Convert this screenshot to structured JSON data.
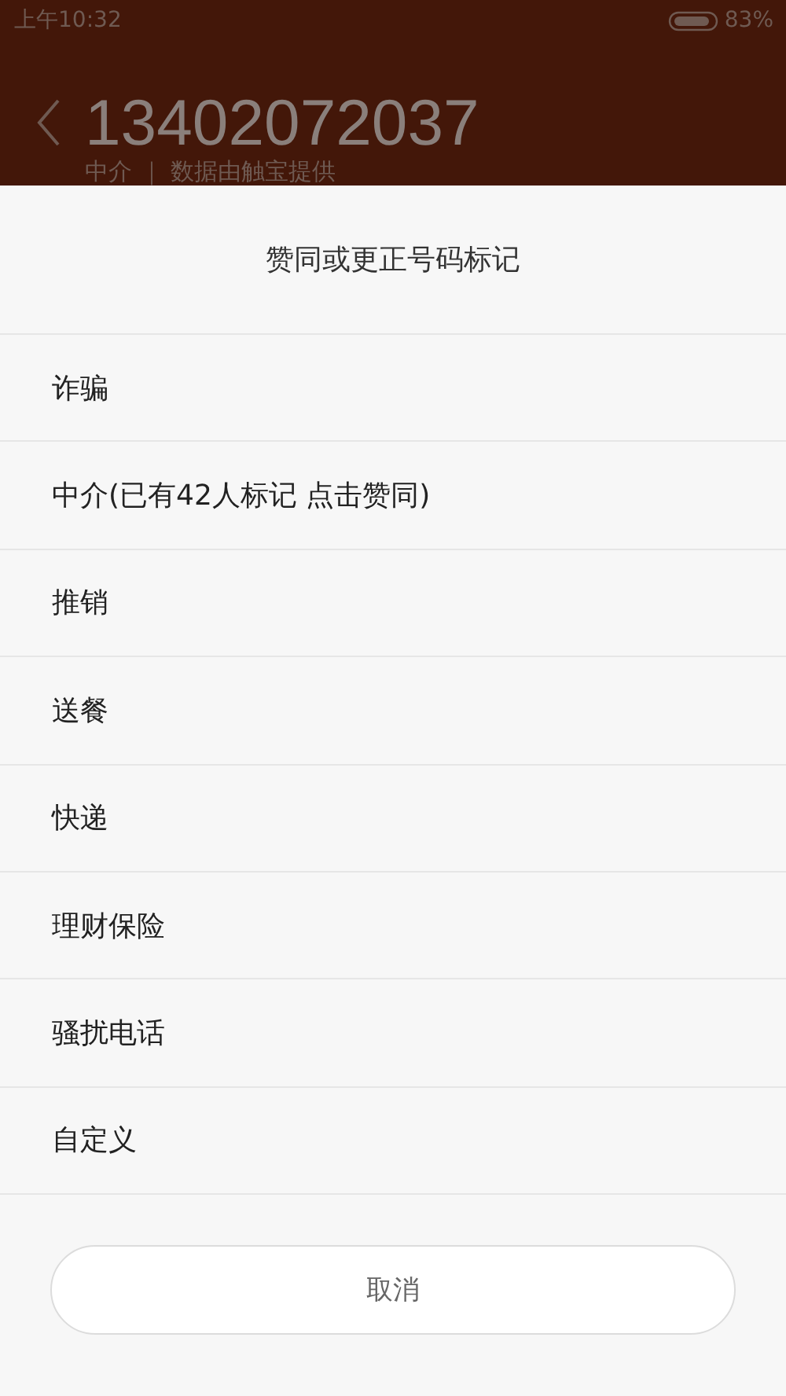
{
  "status_bar": {
    "time": "上午10:32",
    "battery": "83%"
  },
  "header": {
    "number": "13402072037",
    "subtitle": "中介 ｜ 数据由触宝提供"
  },
  "sheet": {
    "title": "赞同或更正号码标记",
    "items": [
      {
        "label": "诈骗"
      },
      {
        "label": "中介(已有42人标记 点击赞同)"
      },
      {
        "label": "推销"
      },
      {
        "label": "送餐"
      },
      {
        "label": "快递"
      },
      {
        "label": "理财保险"
      },
      {
        "label": "骚扰电话"
      },
      {
        "label": "自定义"
      }
    ],
    "cancel": "取消"
  }
}
